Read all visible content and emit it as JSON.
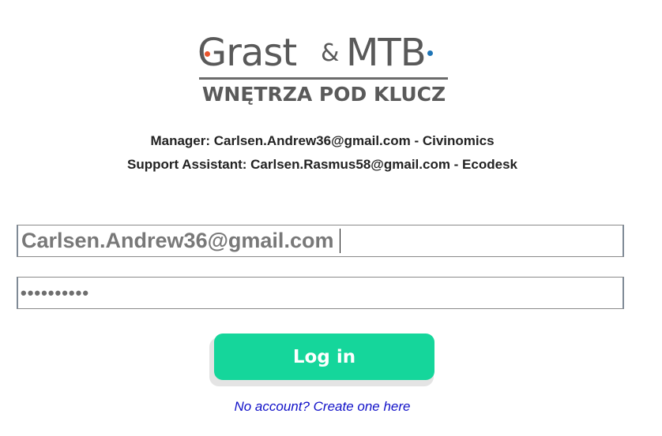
{
  "logo": {
    "brand_left": "Grast",
    "ampersand": "&",
    "brand_right": "MTB",
    "tagline": "WNĘTRZA POD KLUCZ",
    "accent_orange": "#e8542d",
    "accent_blue": "#1f75b6",
    "text_color": "#595959"
  },
  "contacts": {
    "manager": "Manager: Carlsen.Andrew36@gmail.com - Civinomics",
    "support": "Support Assistant: Carlsen.Rasmus58@gmail.com - Ecodesk"
  },
  "form": {
    "email_value": "Carlsen.Andrew36@gmail.com",
    "password_masked": "••••••••••",
    "login_label": "Log in",
    "login_color": "#15d69b",
    "signup_link": "No account? Create one here"
  }
}
